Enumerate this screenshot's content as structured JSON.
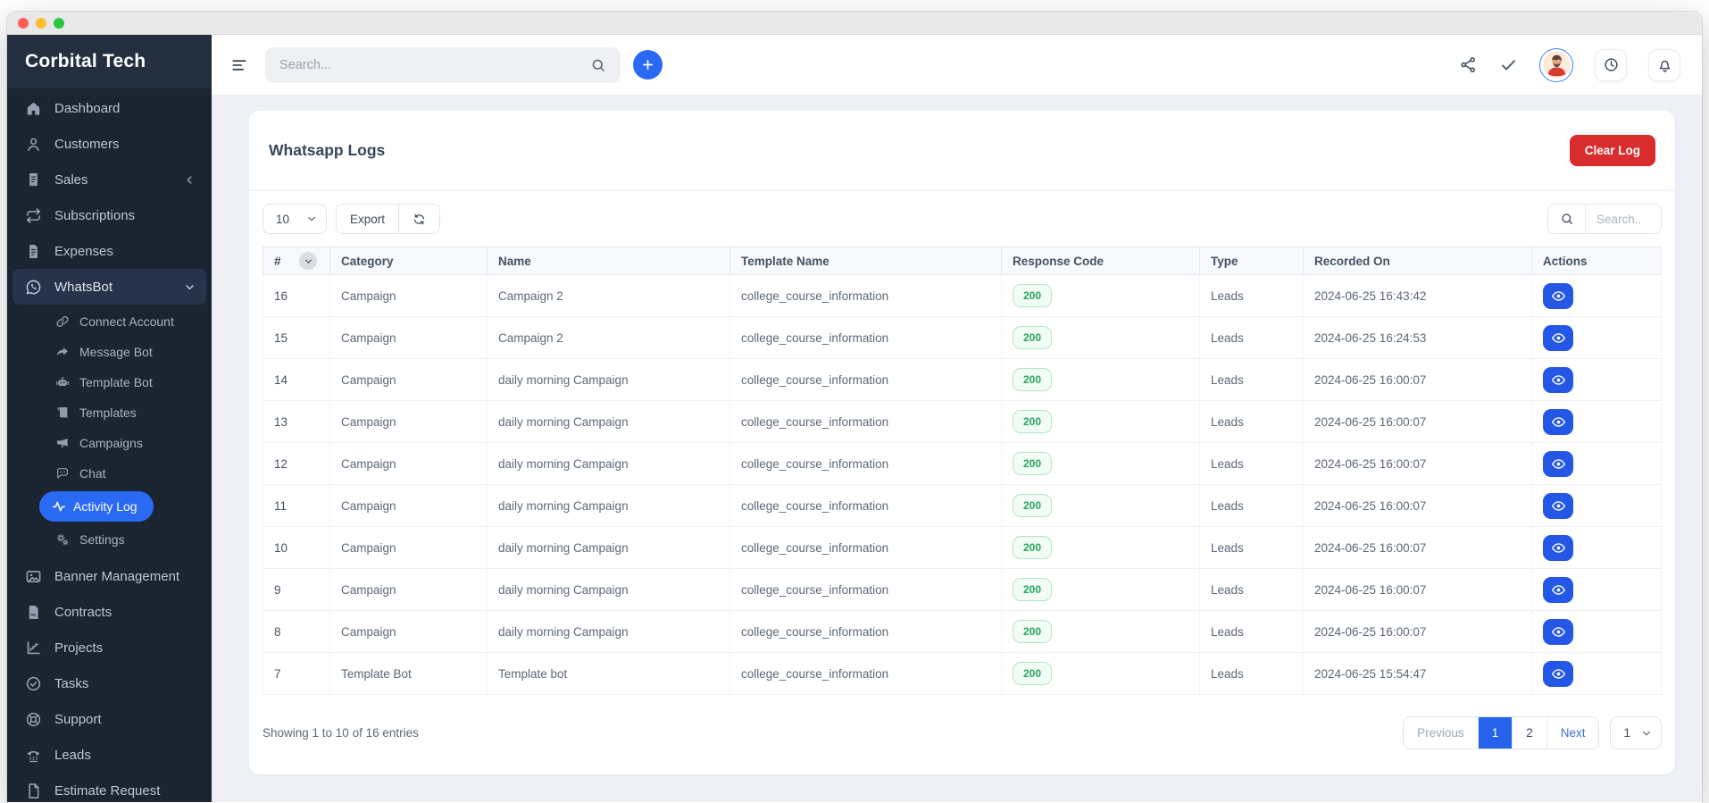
{
  "colors": {
    "accent": "#2563eb",
    "danger": "#d92c2c",
    "success": "#2aa45f",
    "sidebar_bg": "#1b2431",
    "content_bg": "#edf1f6"
  },
  "sidebar": {
    "brand": "Corbital Tech",
    "items": [
      {
        "label": "Dashboard",
        "icon": "home-icon"
      },
      {
        "label": "Customers",
        "icon": "user-icon"
      },
      {
        "label": "Sales",
        "icon": "receipt-icon",
        "chevron": "left"
      },
      {
        "label": "Subscriptions",
        "icon": "repeat-icon"
      },
      {
        "label": "Expenses",
        "icon": "expenses-icon"
      },
      {
        "label": "WhatsBot",
        "icon": "whatsapp-icon",
        "chevron": "down",
        "expanded": true,
        "children": [
          {
            "label": "Connect Account",
            "icon": "link-icon"
          },
          {
            "label": "Message Bot",
            "icon": "forward-arrow-icon"
          },
          {
            "label": "Template Bot",
            "icon": "robot-icon"
          },
          {
            "label": "Templates",
            "icon": "scroll-icon"
          },
          {
            "label": "Campaigns",
            "icon": "megaphone-icon"
          },
          {
            "label": "Chat",
            "icon": "chat-icon"
          },
          {
            "label": "Activity Log",
            "icon": "activity-icon",
            "active": true
          },
          {
            "label": "Settings",
            "icon": "gears-icon"
          }
        ]
      },
      {
        "label": "Banner Management",
        "icon": "image-icon"
      },
      {
        "label": "Contracts",
        "icon": "contract-icon"
      },
      {
        "label": "Projects",
        "icon": "chart-axis-icon"
      },
      {
        "label": "Tasks",
        "icon": "check-circle-icon"
      },
      {
        "label": "Support",
        "icon": "lifebuoy-icon"
      },
      {
        "label": "Leads",
        "icon": "phone-icon"
      },
      {
        "label": "Estimate Request",
        "icon": "file-icon"
      }
    ]
  },
  "topbar": {
    "search_placeholder": "Search...",
    "action_icons": [
      "share-icon",
      "check-icon",
      "avatar",
      "clock-icon",
      "bell-icon"
    ]
  },
  "page": {
    "title": "Whatsapp Logs",
    "clear_log_label": "Clear Log"
  },
  "controls": {
    "page_size": "10",
    "export_label": "Export",
    "search_placeholder": "Search.."
  },
  "table": {
    "columns": [
      "#",
      "Category",
      "Name",
      "Template Name",
      "Response Code",
      "Type",
      "Recorded On",
      "Actions"
    ],
    "rows": [
      {
        "id": "16",
        "category": "Campaign",
        "name": "Campaign 2",
        "template_name": "college_course_information",
        "response_code": "200",
        "type": "Leads",
        "recorded_on": "2024-06-25 16:43:42"
      },
      {
        "id": "15",
        "category": "Campaign",
        "name": "Campaign 2",
        "template_name": "college_course_information",
        "response_code": "200",
        "type": "Leads",
        "recorded_on": "2024-06-25 16:24:53"
      },
      {
        "id": "14",
        "category": "Campaign",
        "name": "daily morning Campaign",
        "template_name": "college_course_information",
        "response_code": "200",
        "type": "Leads",
        "recorded_on": "2024-06-25 16:00:07"
      },
      {
        "id": "13",
        "category": "Campaign",
        "name": "daily morning Campaign",
        "template_name": "college_course_information",
        "response_code": "200",
        "type": "Leads",
        "recorded_on": "2024-06-25 16:00:07"
      },
      {
        "id": "12",
        "category": "Campaign",
        "name": "daily morning Campaign",
        "template_name": "college_course_information",
        "response_code": "200",
        "type": "Leads",
        "recorded_on": "2024-06-25 16:00:07"
      },
      {
        "id": "11",
        "category": "Campaign",
        "name": "daily morning Campaign",
        "template_name": "college_course_information",
        "response_code": "200",
        "type": "Leads",
        "recorded_on": "2024-06-25 16:00:07"
      },
      {
        "id": "10",
        "category": "Campaign",
        "name": "daily morning Campaign",
        "template_name": "college_course_information",
        "response_code": "200",
        "type": "Leads",
        "recorded_on": "2024-06-25 16:00:07"
      },
      {
        "id": "9",
        "category": "Campaign",
        "name": "daily morning Campaign",
        "template_name": "college_course_information",
        "response_code": "200",
        "type": "Leads",
        "recorded_on": "2024-06-25 16:00:07"
      },
      {
        "id": "8",
        "category": "Campaign",
        "name": "daily morning Campaign",
        "template_name": "college_course_information",
        "response_code": "200",
        "type": "Leads",
        "recorded_on": "2024-06-25 16:00:07"
      },
      {
        "id": "7",
        "category": "Template Bot",
        "name": "Template bot",
        "template_name": "college_course_information",
        "response_code": "200",
        "type": "Leads",
        "recorded_on": "2024-06-25 15:54:47"
      }
    ]
  },
  "footer": {
    "summary": "Showing 1 to 10 of 16 entries",
    "pagination": {
      "previous": "Previous",
      "pages": [
        "1",
        "2"
      ],
      "active_page": "1",
      "next": "Next"
    },
    "page_select_value": "1"
  }
}
